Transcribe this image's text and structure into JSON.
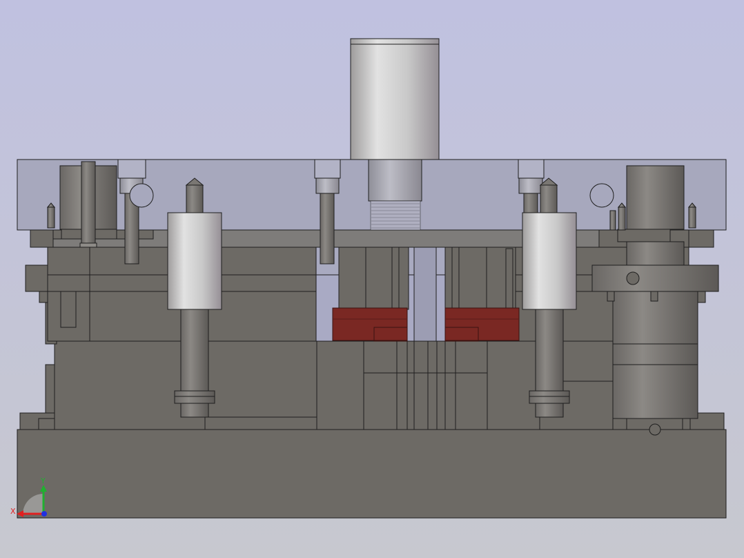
{
  "viewport": {
    "background_top": "#C0C1E0",
    "background_bottom": "#C7C8CF"
  },
  "colors": {
    "steel": "#6D6A65",
    "steel_dark": "#5E5B57",
    "edge": "#1E1E1E",
    "top_plate_glass": "#A9AAC0",
    "red_insert": "#7A2823",
    "bushing_light": "#DCDCDC",
    "bushing_shadow": "#9C989A"
  },
  "triad": {
    "x_label": "X",
    "y_label": "Y",
    "x_color": "#E02020",
    "y_color": "#20B030",
    "z_color": "#2030E0"
  }
}
